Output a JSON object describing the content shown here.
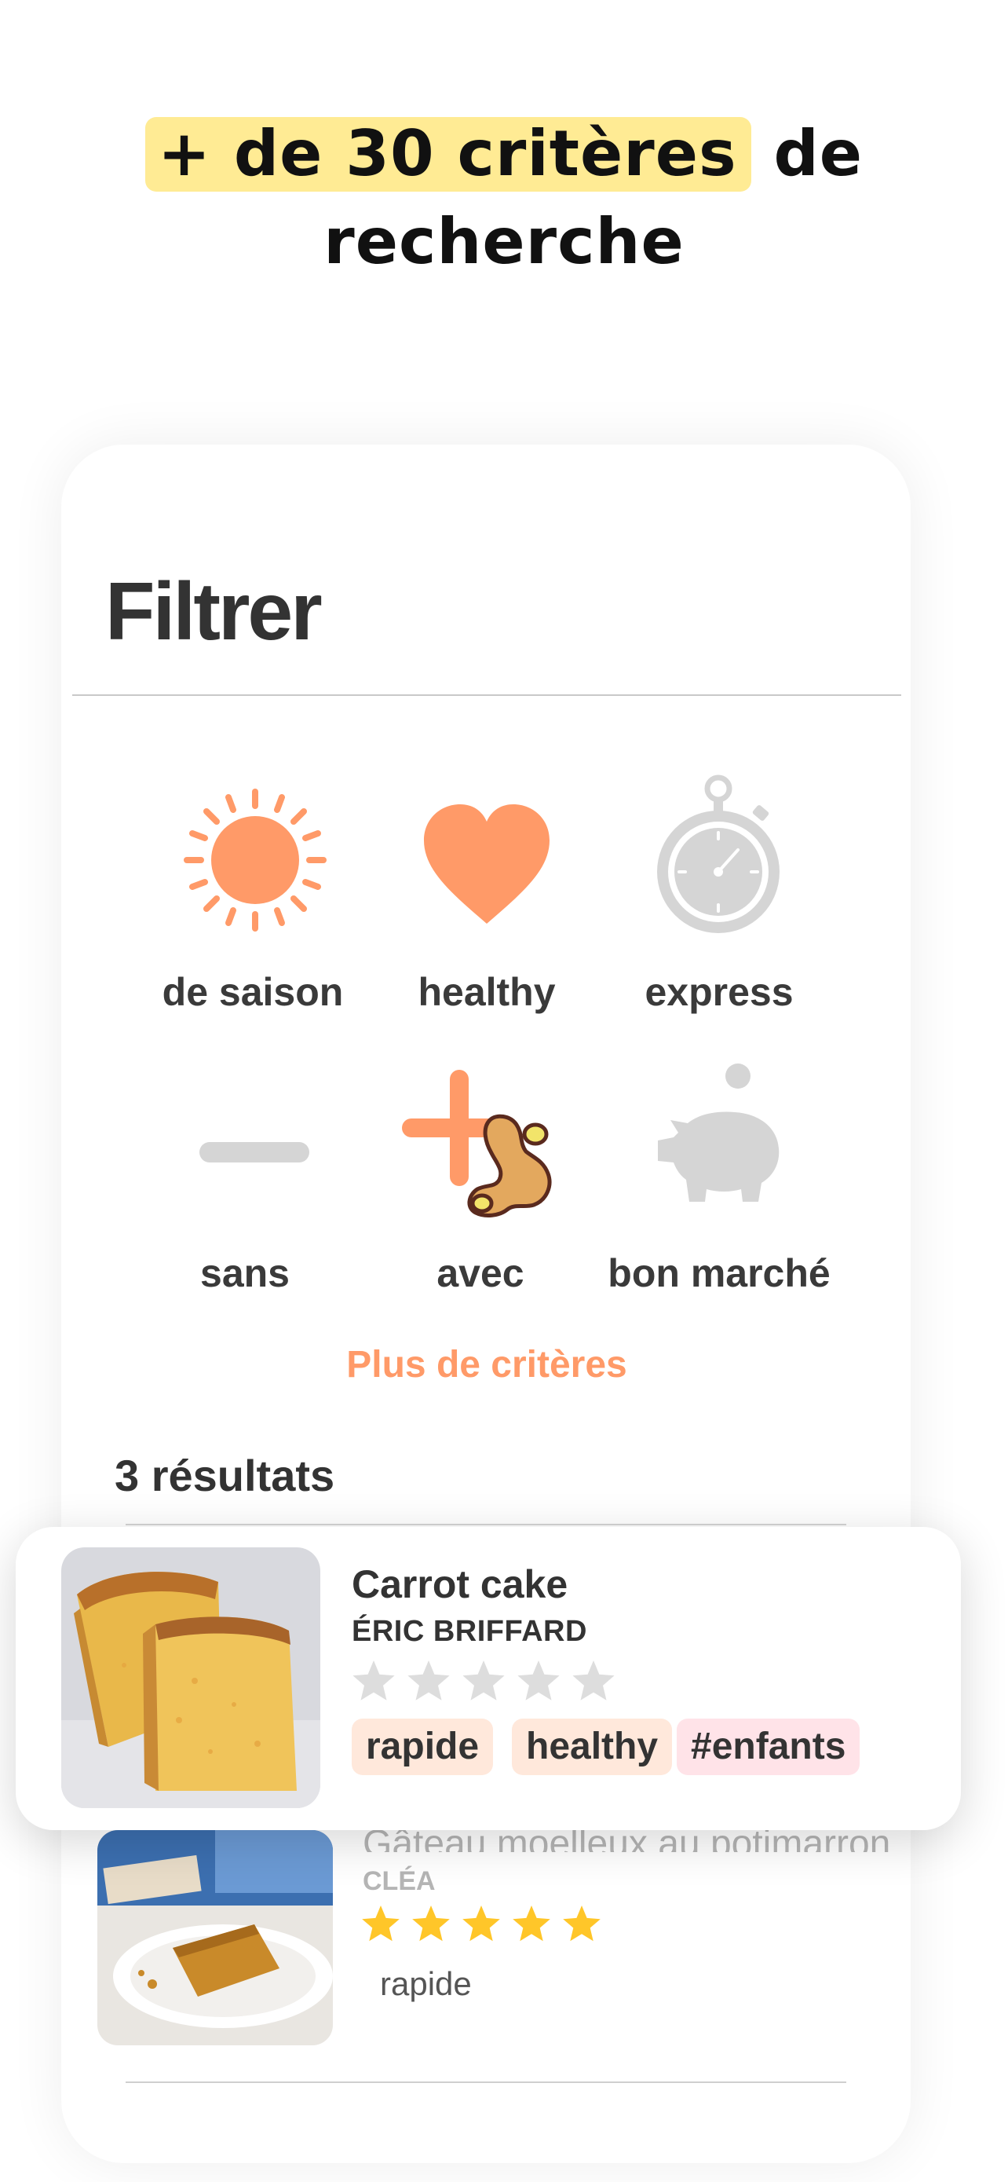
{
  "headline": {
    "highlight": "+ de 30 critères",
    "rest_line1": " de",
    "line2": "recherche"
  },
  "filter": {
    "title": "Filtrer",
    "criteria": [
      {
        "label": "de saison",
        "icon": "sun-icon",
        "color": "#FF9A68"
      },
      {
        "label": "healthy",
        "icon": "heart-icon",
        "color": "#FF9A68"
      },
      {
        "label": "express",
        "icon": "stopwatch-icon",
        "color": "#D5D5D5"
      },
      {
        "label": "sans",
        "icon": "minus-icon",
        "color": "#D5D5D5"
      },
      {
        "label": "avec",
        "icon": "plus-ginger-icon",
        "color": "#FF9A68"
      },
      {
        "label": "bon marché",
        "icon": "piggy-bank-icon",
        "color": "#D5D5D5"
      }
    ],
    "more_label": "Plus de critères",
    "results_label": "3 résultats"
  },
  "recipes": [
    {
      "title": "Carrot cake",
      "author": "ÉRIC BRIFFARD",
      "rating": 0,
      "tags": [
        {
          "label": "rapide",
          "bg": "#FFE8DB"
        },
        {
          "label": "healthy",
          "bg": "#FFE8DB"
        },
        {
          "label": "#enfants",
          "bg": "#FFE3E8"
        }
      ]
    },
    {
      "title": "Gâteau moelleux au potimarron",
      "author": "CLÉA",
      "rating": 5,
      "tags": [
        {
          "label": "rapide"
        }
      ]
    }
  ],
  "colors": {
    "accent": "#FF9A68",
    "highlight": "#FFEB94",
    "star_on": "#FFC629",
    "star_off": "#DDDDDD",
    "inactive": "#D5D5D5"
  }
}
